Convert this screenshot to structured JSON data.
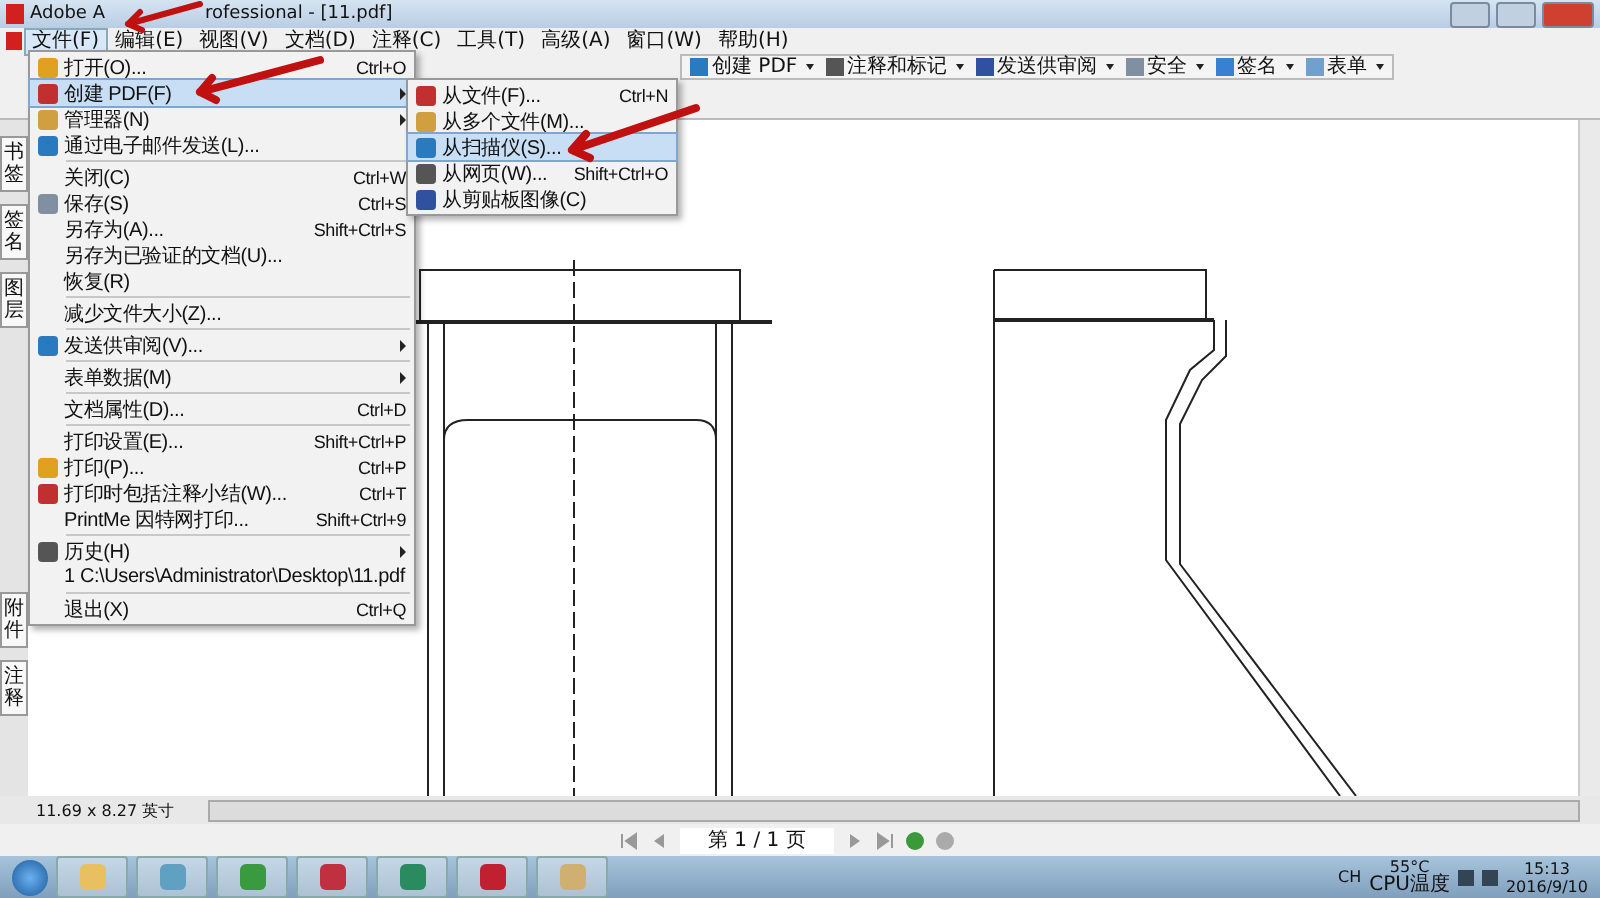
{
  "window": {
    "title_parts": [
      "Adobe A",
      "rofessional - [11.pdf]"
    ]
  },
  "menu_bar": [
    {
      "label": "文件(F)",
      "selected": true
    },
    {
      "label": "编辑(E)",
      "selected": false
    },
    {
      "label": "视图(V)",
      "selected": false
    },
    {
      "label": "文档(D)",
      "selected": false
    },
    {
      "label": "注释(C)",
      "selected": false
    },
    {
      "label": "工具(T)",
      "selected": false
    },
    {
      "label": "高级(A)",
      "selected": false
    },
    {
      "label": "窗口(W)",
      "selected": false
    },
    {
      "label": "帮助(H)",
      "selected": false
    }
  ],
  "toolbar": [
    {
      "label": "创建 PDF"
    },
    {
      "label": "注释和标记"
    },
    {
      "label": "发送供审阅"
    },
    {
      "label": "安全"
    },
    {
      "label": "签名"
    },
    {
      "label": "表单"
    }
  ],
  "side_tabs_top": [
    "书签",
    "签名",
    "图层"
  ],
  "side_tabs_bottom": [
    "附件",
    "注释"
  ],
  "file_menu": [
    {
      "kind": "item",
      "label": "打开(O)...",
      "shortcut": "Ctrl+O",
      "icon": true,
      "submenu": false,
      "selected": false
    },
    {
      "kind": "item",
      "label": "创建 PDF(F)",
      "icon": true,
      "submenu": true,
      "selected": true
    },
    {
      "kind": "item",
      "label": "管理器(N)",
      "icon": true,
      "submenu": true,
      "selected": false
    },
    {
      "kind": "item",
      "label": "通过电子邮件发送(L)...",
      "icon": true,
      "submenu": false,
      "selected": false
    },
    {
      "kind": "separator"
    },
    {
      "kind": "item",
      "label": "关闭(C)",
      "shortcut": "Ctrl+W",
      "icon": false,
      "submenu": false,
      "selected": false
    },
    {
      "kind": "item",
      "label": "保存(S)",
      "shortcut": "Ctrl+S",
      "icon": true,
      "submenu": false,
      "selected": false
    },
    {
      "kind": "item",
      "label": "另存为(A)...",
      "shortcut": "Shift+Ctrl+S",
      "icon": false,
      "submenu": false,
      "selected": false
    },
    {
      "kind": "item",
      "label": "另存为已验证的文档(U)...",
      "icon": false,
      "submenu": false,
      "selected": false
    },
    {
      "kind": "item",
      "label": "恢复(R)",
      "icon": false,
      "submenu": false,
      "selected": false
    },
    {
      "kind": "separator"
    },
    {
      "kind": "item",
      "label": "减少文件大小(Z)...",
      "icon": false,
      "submenu": false,
      "selected": false
    },
    {
      "kind": "separator"
    },
    {
      "kind": "item",
      "label": "发送供审阅(V)...",
      "icon": true,
      "submenu": true,
      "selected": false
    },
    {
      "kind": "separator"
    },
    {
      "kind": "item",
      "label": "表单数据(M)",
      "icon": false,
      "submenu": true,
      "selected": false
    },
    {
      "kind": "separator"
    },
    {
      "kind": "item",
      "label": "文档属性(D)...",
      "shortcut": "Ctrl+D",
      "icon": false,
      "submenu": false,
      "selected": false
    },
    {
      "kind": "separator"
    },
    {
      "kind": "item",
      "label": "打印设置(E)...",
      "shortcut": "Shift+Ctrl+P",
      "icon": false,
      "submenu": false,
      "selected": false
    },
    {
      "kind": "item",
      "label": "打印(P)...",
      "shortcut": "Ctrl+P",
      "icon": true,
      "submenu": false,
      "selected": false
    },
    {
      "kind": "item",
      "label": "打印时包括注释小结(W)...",
      "shortcut": "Ctrl+T",
      "icon": true,
      "submenu": false,
      "selected": false
    },
    {
      "kind": "item",
      "label": "PrintMe 因特网打印...",
      "shortcut": "Shift+Ctrl+9",
      "icon": false,
      "submenu": false,
      "selected": false
    },
    {
      "kind": "separator"
    },
    {
      "kind": "item",
      "label": "历史(H)",
      "icon": true,
      "submenu": true,
      "selected": false
    },
    {
      "kind": "item",
      "label": "1 C:\\Users\\Administrator\\Desktop\\11.pdf",
      "icon": false,
      "submenu": false,
      "selected": false
    },
    {
      "kind": "separator"
    },
    {
      "kind": "item",
      "label": "退出(X)",
      "shortcut": "Ctrl+Q",
      "icon": false,
      "submenu": false,
      "selected": false
    }
  ],
  "create_pdf_submenu": [
    {
      "label": "从文件(F)...",
      "shortcut": "Ctrl+N",
      "selected": false
    },
    {
      "label": "从多个文件(M)...",
      "selected": false
    },
    {
      "label": "从扫描仪(S)...",
      "selected": true
    },
    {
      "label": "从网页(W)...",
      "shortcut": "Shift+Ctrl+O",
      "selected": false
    },
    {
      "label": "从剪贴板图像(C)",
      "selected": false
    }
  ],
  "status_bar": {
    "page_size": "11.69 x 8.27 英寸",
    "page_indicator": "第 1 / 1 页"
  },
  "taskbar": {
    "language": "CH",
    "cpu_temp": "55°C",
    "cpu_label": "CPU温度",
    "time": "15:13",
    "date": "2016/9/10"
  }
}
